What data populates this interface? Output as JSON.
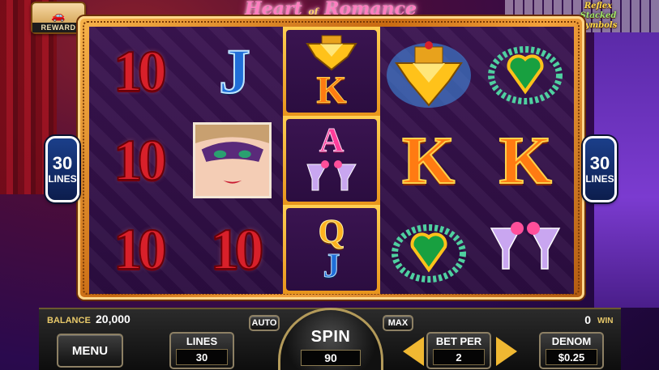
{
  "reward_badge": {
    "label": "REWARD"
  },
  "title": {
    "word1": "Heart",
    "word2": "of",
    "word3": "Romance"
  },
  "feature_badge": {
    "line1": "Reflex",
    "line2": "Stacked",
    "line3": "Symbols"
  },
  "reels": {
    "rows": [
      [
        "10",
        "J",
        "diamond-crown|K",
        "diamond-crown",
        "emerald-necklace"
      ],
      [
        "10",
        "mask-lady",
        "A|champagne-glasses",
        "K",
        "K"
      ],
      [
        "10",
        "10",
        "Q|J",
        "emerald-necklace",
        "champagne-glasses"
      ]
    ]
  },
  "lines_badge_left": {
    "number": "30",
    "label": "LINES"
  },
  "lines_badge_right": {
    "number": "30",
    "label": "LINES"
  },
  "console": {
    "balance_label": "BALANCE",
    "balance_value": "20,000",
    "win_label": "WIN",
    "win_value": "0",
    "menu_label": "MENU",
    "auto_label": "AUTO",
    "max_label": "MAX",
    "lines_label": "LINES",
    "lines_value": "30",
    "spin_label": "SPIN",
    "spin_value": "90",
    "betper_label": "BET PER",
    "betper_value": "2",
    "denom_label": "DENOM",
    "denom_value": "$0.25"
  },
  "colors": {
    "accent_gold": "#f0b832",
    "frame_orange": "#c86a12",
    "reel_bg": "#2b0d40",
    "label_gold": "#e8c96a"
  }
}
